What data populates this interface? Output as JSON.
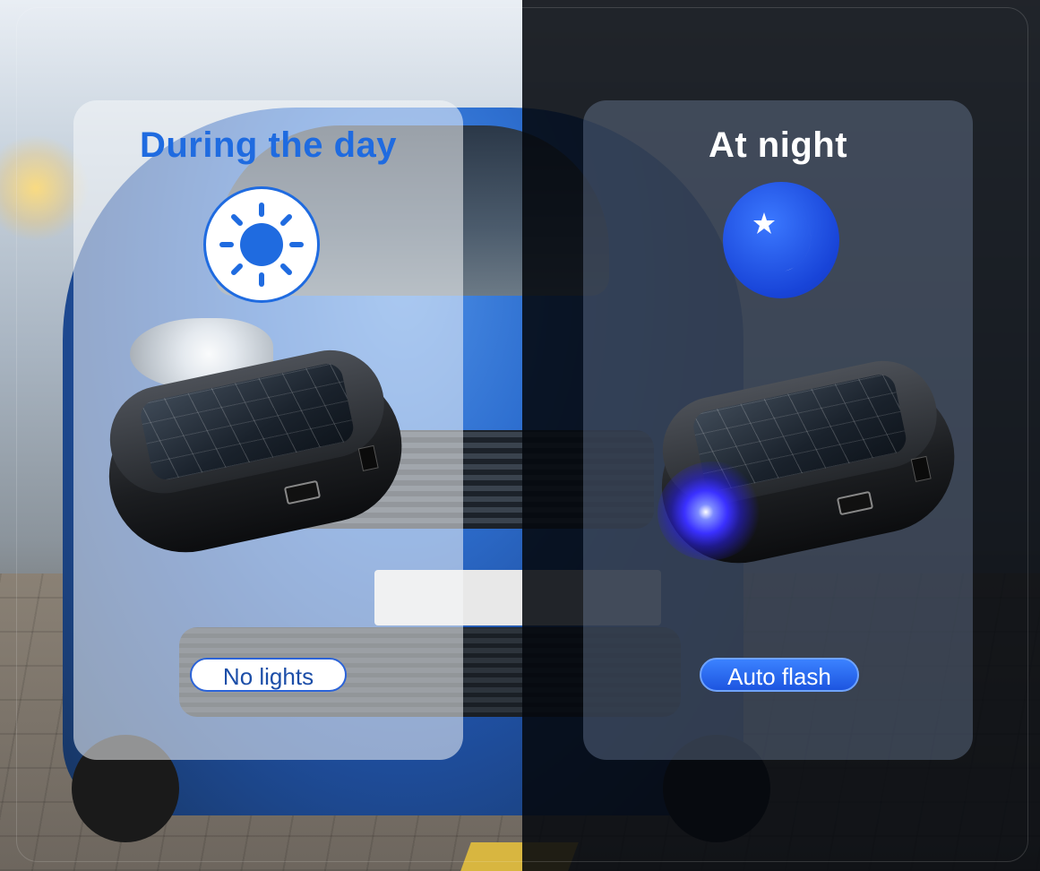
{
  "panels": {
    "day": {
      "title": "During the day",
      "badge": "No lights",
      "icon": "sun-icon",
      "accent": "#1f6be0"
    },
    "night": {
      "title": "At night",
      "badge": "Auto flash",
      "icon": "moon-star-icon",
      "accent": "#1844d8"
    }
  },
  "colors": {
    "day_title": "#1f6be0",
    "night_title": "#ffffff",
    "device_glow": "#3a30ff"
  }
}
